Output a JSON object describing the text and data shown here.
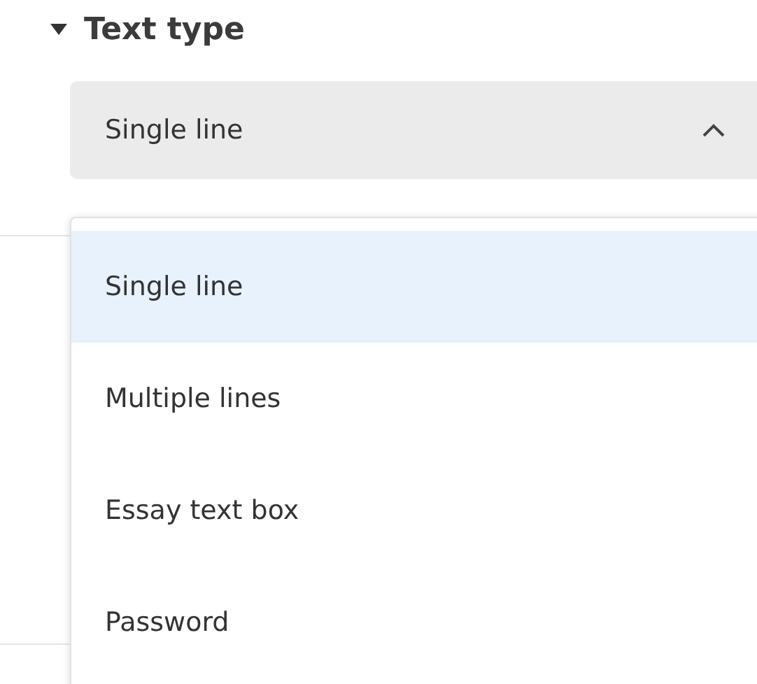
{
  "section": {
    "title": "Text type",
    "expanded": true
  },
  "select": {
    "value": "Single line",
    "open": true
  },
  "options": [
    {
      "label": "Single line",
      "selected": true
    },
    {
      "label": "Multiple lines",
      "selected": false
    },
    {
      "label": "Essay text box",
      "selected": false
    },
    {
      "label": "Password",
      "selected": false
    }
  ]
}
